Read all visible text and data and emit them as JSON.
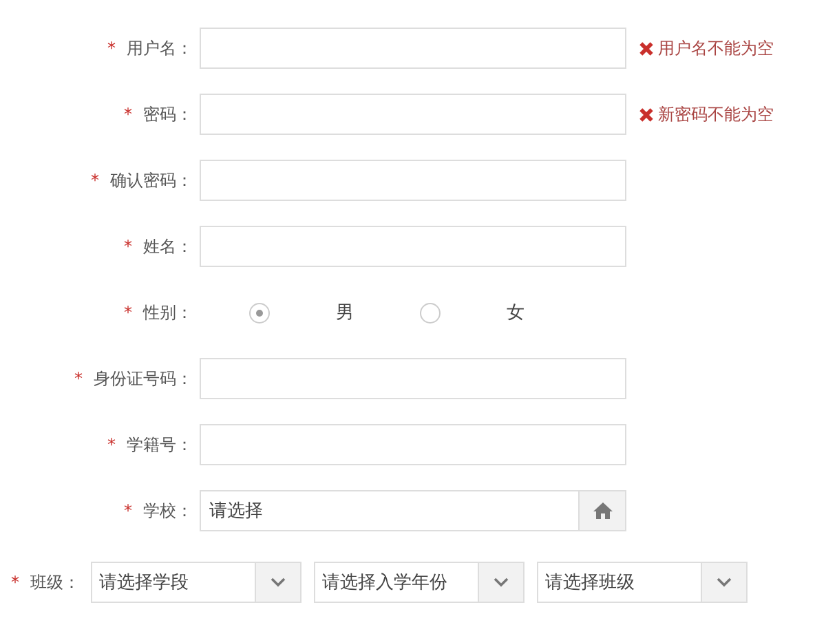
{
  "form": {
    "fields": [
      {
        "kind": "text",
        "marker": "*",
        "label": "用户名：",
        "error": "用户名不能为空"
      },
      {
        "kind": "text",
        "marker": "*",
        "label": "密码：",
        "error": "新密码不能为空"
      },
      {
        "kind": "text",
        "marker": "*",
        "label": "确认密码："
      },
      {
        "kind": "text",
        "marker": "*",
        "label": "姓名："
      },
      {
        "kind": "radio",
        "marker": "*",
        "label": "性别：",
        "options": [
          {
            "label": "男",
            "selected": true
          },
          {
            "label": "女",
            "selected": false
          }
        ]
      },
      {
        "kind": "text",
        "marker": "*",
        "label": "身份证号码："
      },
      {
        "kind": "text",
        "marker": "*",
        "label": "学籍号："
      },
      {
        "kind": "picker",
        "marker": "*",
        "label": "学校：",
        "value": "请选择"
      }
    ],
    "class_row": {
      "marker": "*",
      "label": "班级：",
      "selects": [
        {
          "value": "请选择学段"
        },
        {
          "value": "请选择入学年份"
        },
        {
          "value": "请选择班级"
        }
      ]
    }
  }
}
